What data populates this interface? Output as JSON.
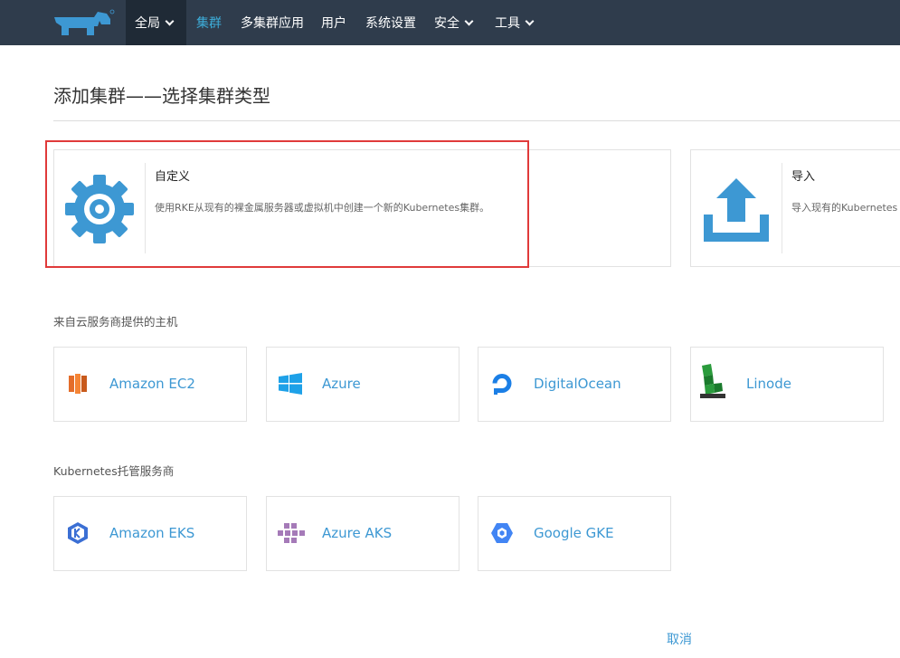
{
  "nav": {
    "global": "全局",
    "items": [
      "集群",
      "多集群应用",
      "用户",
      "系统设置",
      "安全",
      "工具"
    ]
  },
  "page": {
    "title": "添加集群——选择集群类型"
  },
  "types": [
    {
      "name": "自定义",
      "desc": "使用RKE从现有的裸金属服务器或虚拟机中创建一个新的Kubernetes集群。",
      "icon": "gear-icon"
    },
    {
      "name": "导入",
      "desc": "导入现有的Kubernetes",
      "icon": "upload-icon"
    }
  ],
  "sections": {
    "cloud": "来自云服务商提供的主机",
    "hosted": "Kubernetes托管服务商"
  },
  "cloud_providers": [
    "Amazon EC2",
    "Azure",
    "DigitalOcean",
    "Linode"
  ],
  "hosted_providers": [
    "Amazon EKS",
    "Azure AKS",
    "Google GKE"
  ],
  "footer": {
    "cancel": "取消"
  },
  "colors": {
    "nav_bg": "#2f3c4c",
    "accent": "#3d98d3",
    "highlight": "#e03a3a"
  }
}
